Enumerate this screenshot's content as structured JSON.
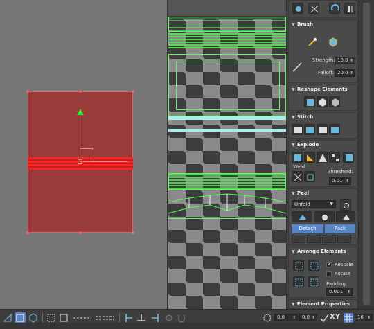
{
  "sections": {
    "brush": {
      "title": "Brush",
      "strength_label": "Strength:",
      "strength_value": "10.0",
      "falloff_label": "Falloff:",
      "falloff_value": "20.0"
    },
    "reshape": {
      "title": "Reshape Elements"
    },
    "stitch": {
      "title": "Stitch"
    },
    "explode": {
      "title": "Explode",
      "weld_label": "Weld",
      "threshold_label": "Threshold:",
      "threshold_value": "0.01"
    },
    "peel": {
      "title": "Peel",
      "mode_selected": "Unfold",
      "detach_label": "Detach",
      "pack_label": "Pack"
    },
    "arrange": {
      "title": "Arrange Elements",
      "rescale_label": "Rescale",
      "rescale_checked": "✔",
      "rotate_label": "Rotate",
      "padding_label": "Padding:",
      "padding_value": "0.001"
    },
    "element_properties": {
      "title": "Element Properties"
    }
  },
  "toolbar": {
    "value_left": "0.0",
    "value_right": "0.0",
    "axis_label": "XY",
    "grid_value": "16"
  },
  "colors": {
    "shell_fill": "#9a3b3b",
    "selected_edge": "#ff2222",
    "gizmo_y": "#22ee22",
    "uv_wire": "#55ff55",
    "accent_button": "#5784c6"
  }
}
